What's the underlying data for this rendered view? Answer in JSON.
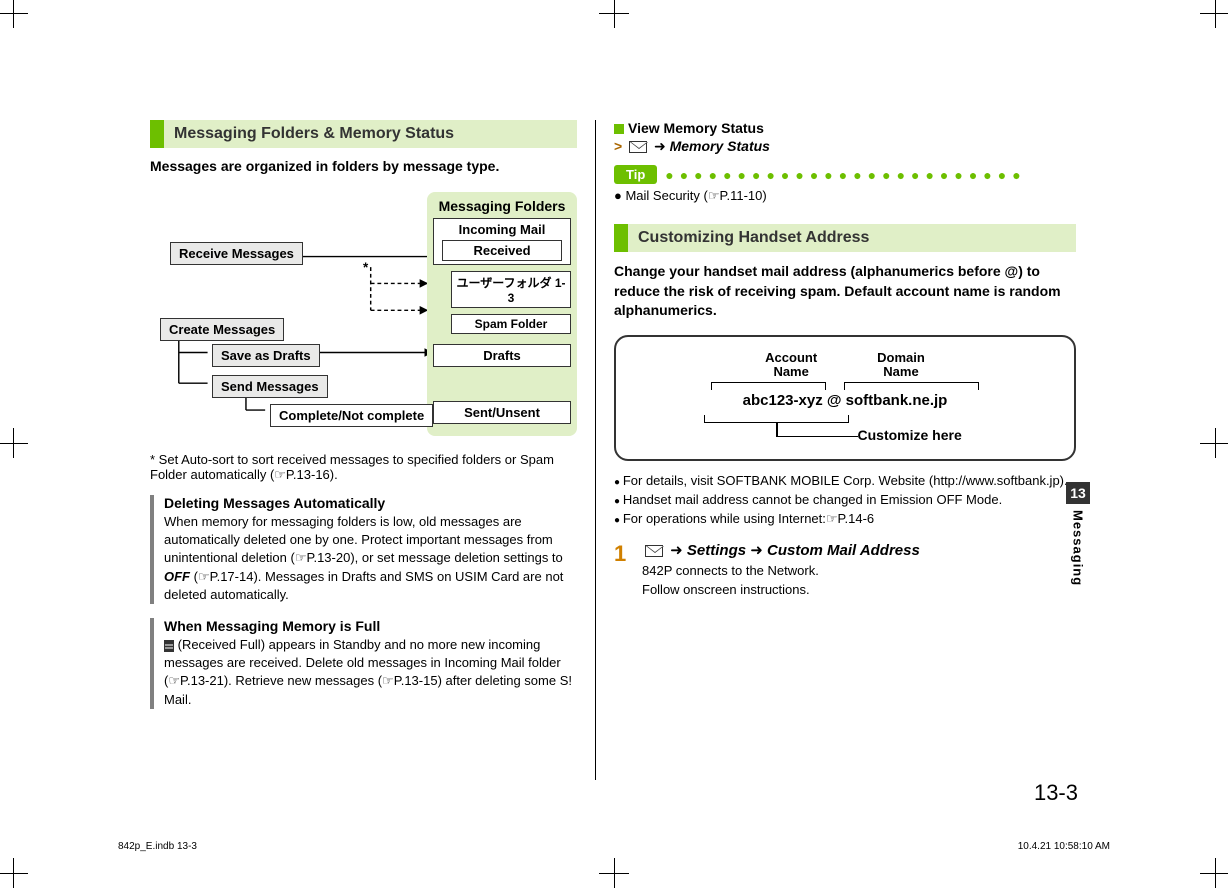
{
  "left": {
    "section_title": "Messaging Folders & Memory Status",
    "intro": "Messages are organized in folders by message type.",
    "folders_label": "Messaging Folders",
    "incoming_mail": "Incoming Mail",
    "received": "Received",
    "user_folder": "ユーザーフォルダ 1-3",
    "spam_folder": "Spam Folder",
    "drafts": "Drafts",
    "sent_unsent": "Sent/Unsent",
    "receive_messages": "Receive Messages",
    "create_messages": "Create Messages",
    "save_as_drafts": "Save as Drafts",
    "send_messages": "Send Messages",
    "complete_not_complete": "Complete/Not complete",
    "star": "*",
    "footnote": "* Set Auto-sort to sort received messages to specified folders or Spam Folder automatically (☞P.13-16).",
    "del_title": "Deleting Messages Automatically",
    "del_body_1": "When memory for messaging folders is low, old messages are automatically deleted one by one. Protect important messages from unintentional deletion (☞P.13-20), or set message deletion settings to ",
    "del_off": "OFF",
    "del_body_2": " (☞P.17-14). Messages in Drafts and SMS on USIM Card are not deleted automatically.",
    "full_title": "When Messaging Memory is Full",
    "full_body": " (Received Full) appears in Standby and no more new incoming messages are received. Delete old messages in Incoming Mail folder (☞P.13-21). Retrieve new messages (☞P.13-15) after deleting some S! Mail."
  },
  "right": {
    "view_memory": "View Memory Status",
    "memory_status": "Memory Status",
    "tip_label": "Tip",
    "tip_item": "Mail Security (☞P.11-10)",
    "section_title": "Customizing Handset Address",
    "desc": "Change your handset mail address (alphanumerics before @) to reduce the risk of receiving spam. Default account name is random alphanumerics.",
    "account_name_label": "Account\nName",
    "domain_name_label": "Domain\nName",
    "email_example": "abc123-xyz @ softbank.ne.jp",
    "customize_here": "Customize here",
    "note1": "For details, visit SOFTBANK MOBILE Corp. Website (http://www.softbank.jp).",
    "note2": "Handset mail address cannot be changed in Emission OFF Mode.",
    "note3": "For operations while using Internet:☞P.14-6",
    "step1_num": "1",
    "step1_settings": "Settings",
    "step1_cma": "Custom Mail Address",
    "step1_sub1": "842P connects to the Network.",
    "step1_sub2": "Follow onscreen instructions."
  },
  "side": {
    "chapter": "13",
    "label": "Messaging"
  },
  "page_num": "13-3",
  "footer": {
    "left": "842p_E.indb   13-3",
    "right": "10.4.21   10:58:10 AM"
  }
}
